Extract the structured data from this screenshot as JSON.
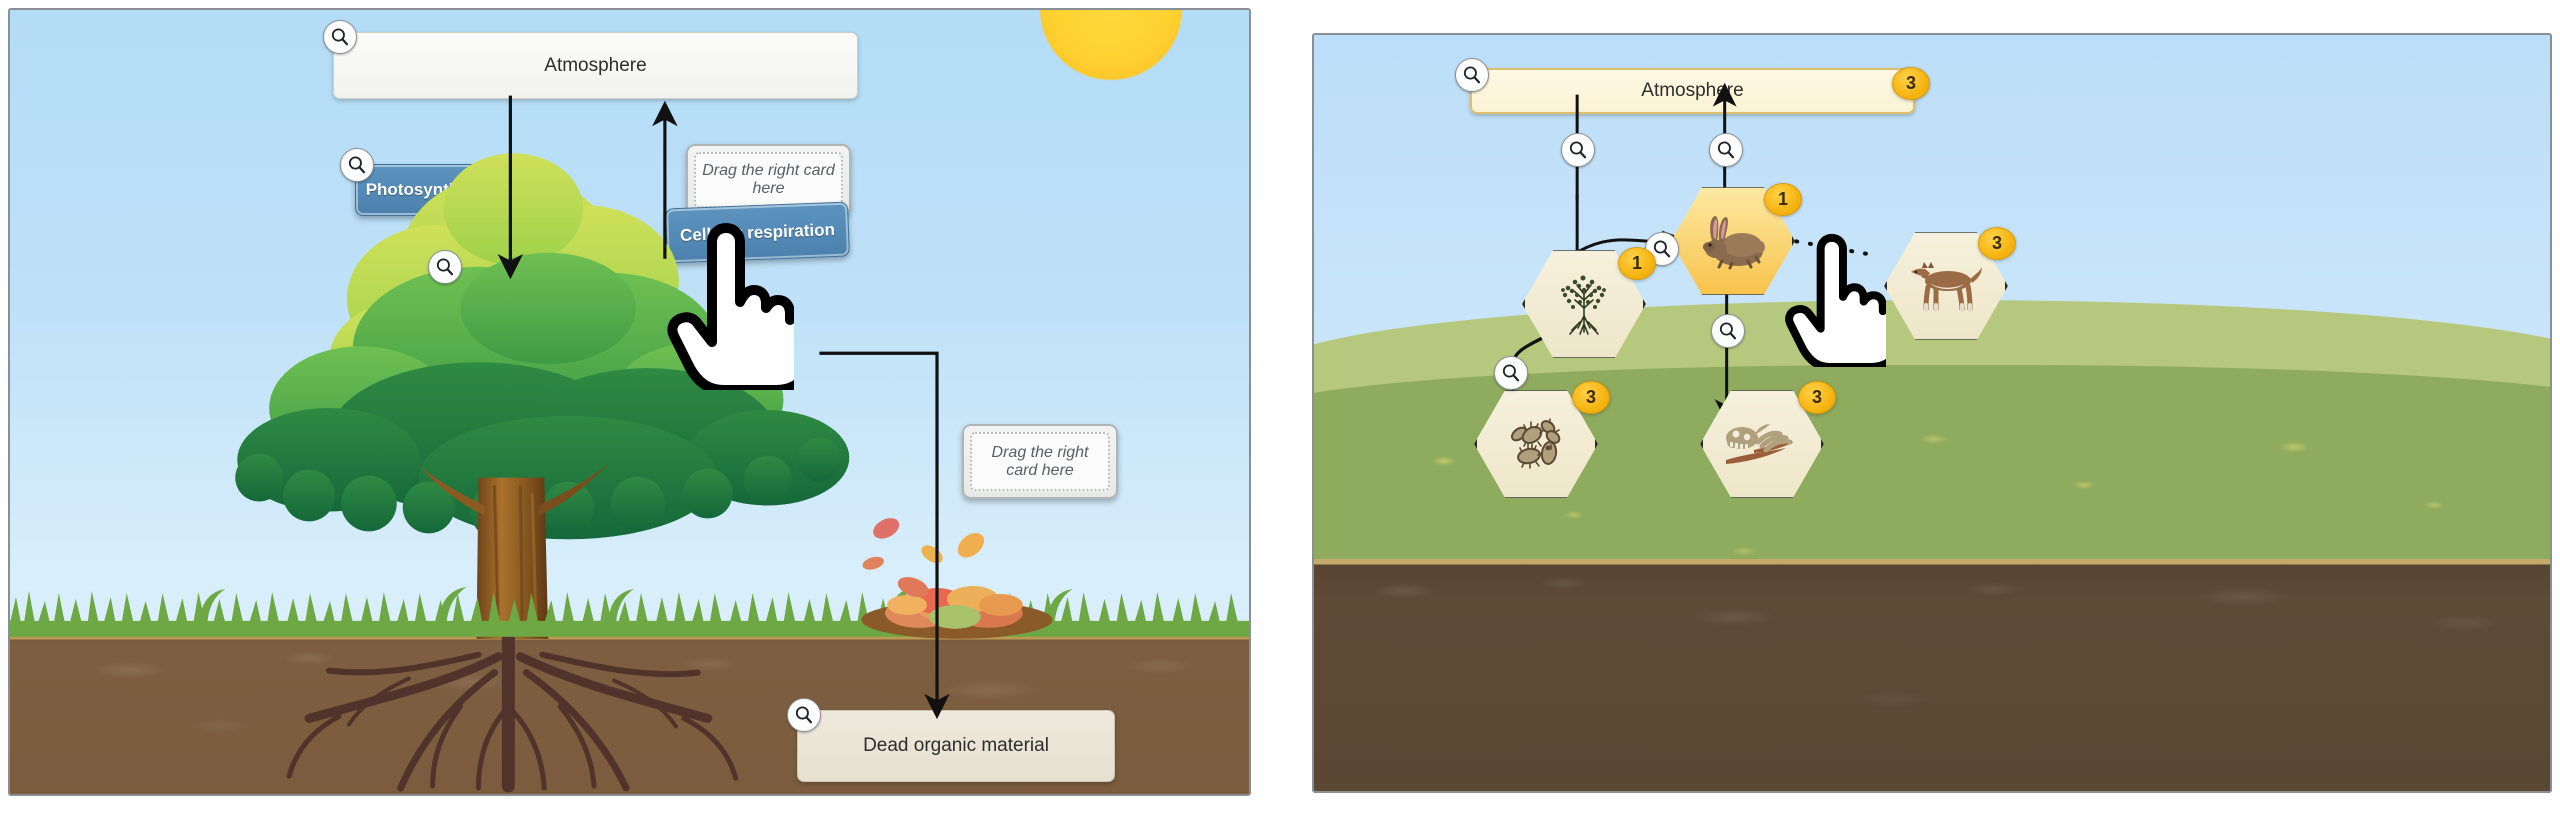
{
  "left_panel": {
    "name": "carbon-cycle-tree-scene",
    "atmosphere_box": {
      "label": "Atmosphere"
    },
    "photosynthesis_card": {
      "label": "Photosynthesis"
    },
    "cellular_respiration_card": {
      "label": "Cellular respiration"
    },
    "dropzone_top": {
      "placeholder": "Drag the right card here"
    },
    "dropzone_right": {
      "placeholder": "Drag the right card here"
    },
    "dead_organic_box": {
      "label": "Dead organic material"
    },
    "magnifier_icon": "search-icon",
    "cursor_icon": "pointing-hand-cursor",
    "sun_icon": "sun",
    "colors": {
      "sky": "#bfe1f8",
      "grass": "#6ea845",
      "soil": "#7b5c3d",
      "card_blue": "#4b81ac",
      "box_plain": "#f2f2ef",
      "box_tan": "#e6e0d0",
      "sun": "#ffd231"
    },
    "magnifiers": [
      {
        "name": "magnifier-atmosphere"
      },
      {
        "name": "magnifier-photosynthesis"
      },
      {
        "name": "magnifier-tree"
      },
      {
        "name": "magnifier-dead-organic"
      }
    ]
  },
  "right_panel": {
    "name": "food-web-hex-scene",
    "atmosphere_box": {
      "label": "Atmosphere",
      "badge": "3"
    },
    "nodes": [
      {
        "name": "hex-node-tree",
        "icon": "tree-icon",
        "badge": "1",
        "style": "beige"
      },
      {
        "name": "hex-node-rabbit",
        "icon": "rabbit-icon",
        "badge": "1",
        "style": "gold"
      },
      {
        "name": "hex-node-wolf",
        "icon": "wolf-icon",
        "badge": "3",
        "style": "beige"
      },
      {
        "name": "hex-node-bacteria",
        "icon": "bacteria-icon",
        "badge": "3",
        "style": "beige"
      },
      {
        "name": "hex-node-carcass",
        "icon": "skeleton-icon",
        "badge": "3",
        "style": "beige"
      }
    ],
    "magnifiers": [
      {
        "name": "magnifier-atmosphere"
      },
      {
        "name": "magnifier-atmosphere-to-tree"
      },
      {
        "name": "magnifier-rabbit-to-atmosphere"
      },
      {
        "name": "magnifier-tree-to-rabbit"
      },
      {
        "name": "magnifier-rabbit-down"
      },
      {
        "name": "magnifier-tree-to-carcass"
      }
    ],
    "cursor_icon": "pointing-hand-cursor",
    "sun_icon": "sun",
    "colors": {
      "sky": "#cbe6fa",
      "hill_back": "#b6c87e",
      "hill_front": "#8fab5e",
      "soil": "#5a4833",
      "hex_beige": "#f0e8cd",
      "hex_gold": "#f8c24a",
      "badge": "#f6b412",
      "box_cream": "#fbf3d4",
      "box_border": "#e0bf6a"
    }
  }
}
